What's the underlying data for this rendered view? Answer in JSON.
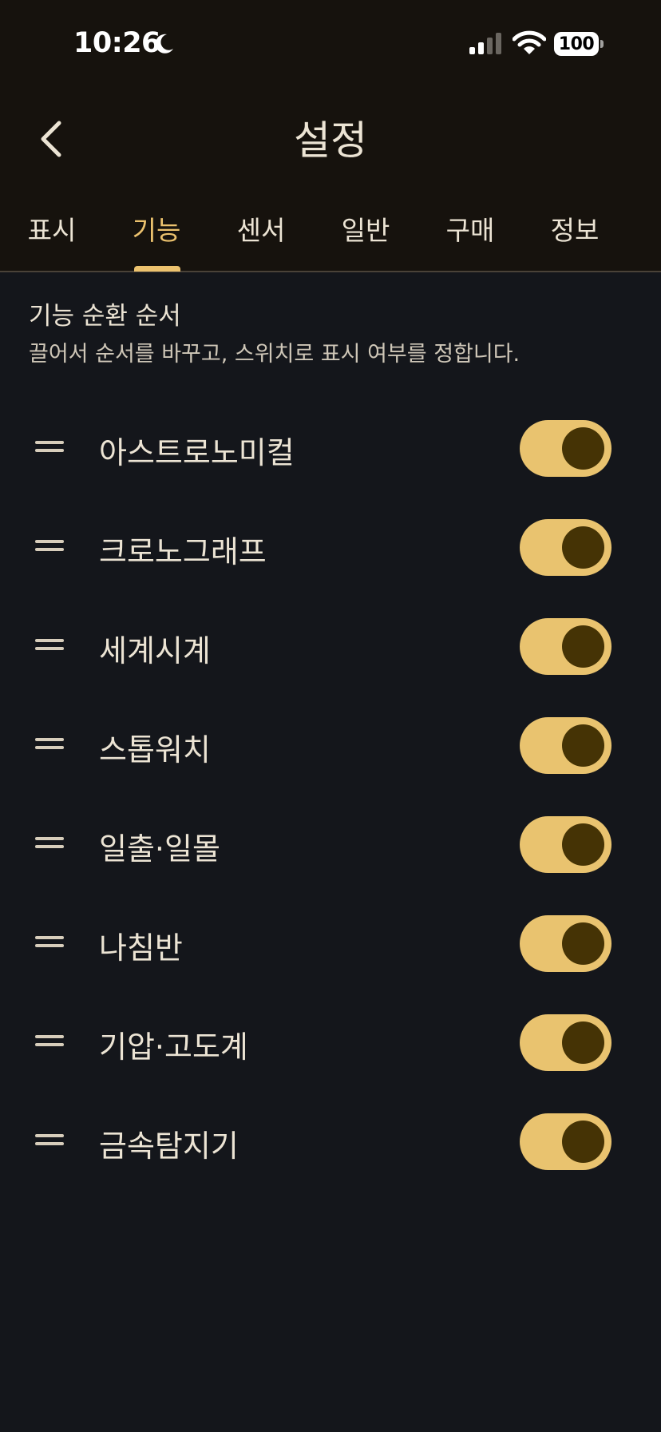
{
  "status_bar": {
    "time": "10:26",
    "battery": "100"
  },
  "header": {
    "title": "설정",
    "back_icon": "chevron-left-icon"
  },
  "tabs": [
    {
      "label": "표시",
      "active": false
    },
    {
      "label": "기능",
      "active": true
    },
    {
      "label": "센서",
      "active": false
    },
    {
      "label": "일반",
      "active": false
    },
    {
      "label": "구매",
      "active": false
    },
    {
      "label": "정보",
      "active": false
    }
  ],
  "section": {
    "title": "기능 순환 순서",
    "description": "끌어서 순서를 바꾸고, 스위치로 표시 여부를 정합니다."
  },
  "features": [
    {
      "label": "아스트로노미컬",
      "enabled": true
    },
    {
      "label": "크로노그래프",
      "enabled": true
    },
    {
      "label": "세계시계",
      "enabled": true
    },
    {
      "label": "스톱워치",
      "enabled": true
    },
    {
      "label": "일출·일몰",
      "enabled": true
    },
    {
      "label": "나침반",
      "enabled": true
    },
    {
      "label": "기압·고도계",
      "enabled": true
    },
    {
      "label": "금속탐지기",
      "enabled": true
    }
  ],
  "colors": {
    "accent": "#ecc26e",
    "toggle_track": "#e9c36f",
    "toggle_knob": "#453305",
    "header_bg": "#16120d",
    "body_bg": "#14161b"
  }
}
